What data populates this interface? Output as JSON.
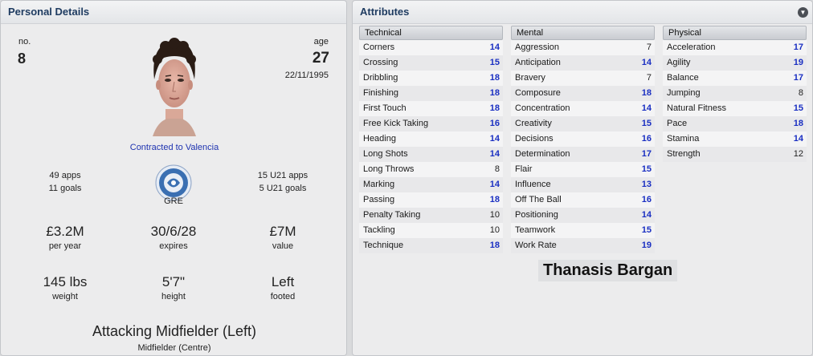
{
  "left_panel": {
    "title": "Personal Details",
    "number_label": "no.",
    "number": "8",
    "age_label": "age",
    "age": "27",
    "dob": "22/11/1995",
    "contract": "Contracted to Valencia",
    "apps": "49 apps",
    "goals": "11 goals",
    "nation": "GRE",
    "u21_apps": "15 U21 apps",
    "u21_goals": "5 U21 goals",
    "wage": "£3.2M",
    "wage_label": "per year",
    "expires": "30/6/28",
    "expires_label": "expires",
    "value": "£7M",
    "value_label": "value",
    "weight": "145 lbs",
    "weight_label": "weight",
    "height": "5'7\"",
    "height_label": "height",
    "footed": "Left",
    "footed_label": "footed",
    "position": "Attacking Midfielder (Left)",
    "secondary_position": "Midfielder (Centre)"
  },
  "right_panel": {
    "title": "Attributes",
    "collapse_icon": "chevron-down-icon",
    "player_name": "Thanasis Bargan",
    "highlight_color": "#1a2fc2",
    "columns": [
      {
        "header": "Technical",
        "rows": [
          {
            "label": "Corners",
            "value": "14"
          },
          {
            "label": "Crossing",
            "value": "15"
          },
          {
            "label": "Dribbling",
            "value": "18"
          },
          {
            "label": "Finishing",
            "value": "18"
          },
          {
            "label": "First Touch",
            "value": "18"
          },
          {
            "label": "Free Kick Taking",
            "value": "16"
          },
          {
            "label": "Heading",
            "value": "14"
          },
          {
            "label": "Long Shots",
            "value": "14"
          },
          {
            "label": "Long Throws",
            "value": "8"
          },
          {
            "label": "Marking",
            "value": "14"
          },
          {
            "label": "Passing",
            "value": "18"
          },
          {
            "label": "Penalty Taking",
            "value": "10"
          },
          {
            "label": "Tackling",
            "value": "10"
          },
          {
            "label": "Technique",
            "value": "18"
          }
        ]
      },
      {
        "header": "Mental",
        "rows": [
          {
            "label": "Aggression",
            "value": "7"
          },
          {
            "label": "Anticipation",
            "value": "14"
          },
          {
            "label": "Bravery",
            "value": "7"
          },
          {
            "label": "Composure",
            "value": "18"
          },
          {
            "label": "Concentration",
            "value": "14"
          },
          {
            "label": "Creativity",
            "value": "15"
          },
          {
            "label": "Decisions",
            "value": "16"
          },
          {
            "label": "Determination",
            "value": "17"
          },
          {
            "label": "Flair",
            "value": "15"
          },
          {
            "label": "Influence",
            "value": "13"
          },
          {
            "label": "Off The Ball",
            "value": "16"
          },
          {
            "label": "Positioning",
            "value": "14"
          },
          {
            "label": "Teamwork",
            "value": "15"
          },
          {
            "label": "Work Rate",
            "value": "19"
          }
        ]
      },
      {
        "header": "Physical",
        "rows": [
          {
            "label": "Acceleration",
            "value": "17"
          },
          {
            "label": "Agility",
            "value": "19"
          },
          {
            "label": "Balance",
            "value": "17"
          },
          {
            "label": "Jumping",
            "value": "8"
          },
          {
            "label": "Natural Fitness",
            "value": "15"
          },
          {
            "label": "Pace",
            "value": "18"
          },
          {
            "label": "Stamina",
            "value": "14"
          },
          {
            "label": "Strength",
            "value": "12"
          }
        ]
      }
    ]
  }
}
